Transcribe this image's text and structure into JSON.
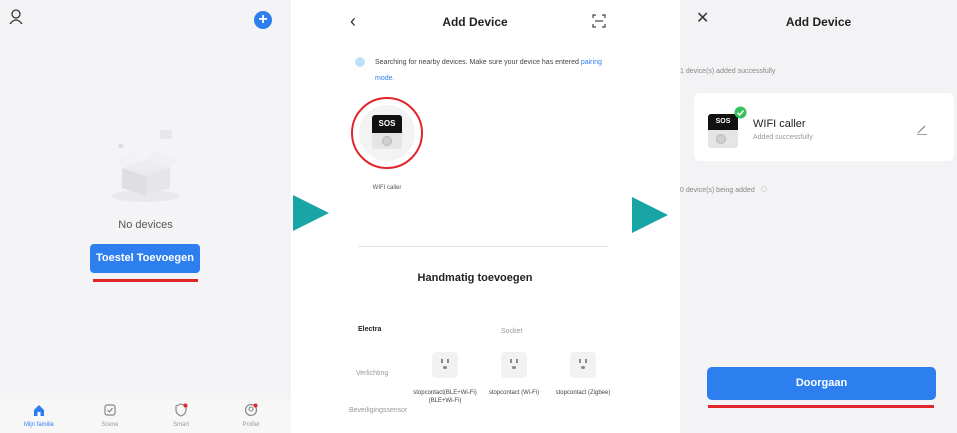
{
  "panel1": {
    "empty_text": "No devices",
    "add_button": "Toestel Toevoegen",
    "tabs": [
      {
        "label": "Mijn familie",
        "icon": "home-icon"
      },
      {
        "label": "Scene",
        "icon": "scene-icon"
      },
      {
        "label": "Smart",
        "icon": "smart-icon"
      },
      {
        "label": "Profiel",
        "icon": "profile-icon"
      }
    ],
    "accent": "#2d7ff0"
  },
  "panel2": {
    "title": "Add Device",
    "search_text": "Searching for nearby devices. Make sure your device has entered",
    "search_link": "pairing mode.",
    "device_label": "WIFI caller",
    "device_badge": "SOS",
    "manual_title": "Handmatig toevoegen",
    "categories": [
      "Electra",
      "Socket",
      "Verlichting",
      "Beveiligingssensor"
    ],
    "sockets": [
      "stopcontact(BLE+Wi-Fi) (BLE+Wi-Fi)",
      "stopcontact (Wi-Fi)",
      "stopcontact (Zigbee)"
    ]
  },
  "panel3": {
    "title": "Add Device",
    "added_status": "1 device(s) added successfully",
    "device_name": "WIFI caller",
    "device_status": "Added successfully",
    "device_badge": "SOS",
    "pending_status": "0 device(s) being added",
    "continue_button": "Doorgaan"
  },
  "colors": {
    "arrow": "#19a5a5",
    "highlight": "#e0262a",
    "primary": "#2d7ff0",
    "success": "#35c25c"
  }
}
